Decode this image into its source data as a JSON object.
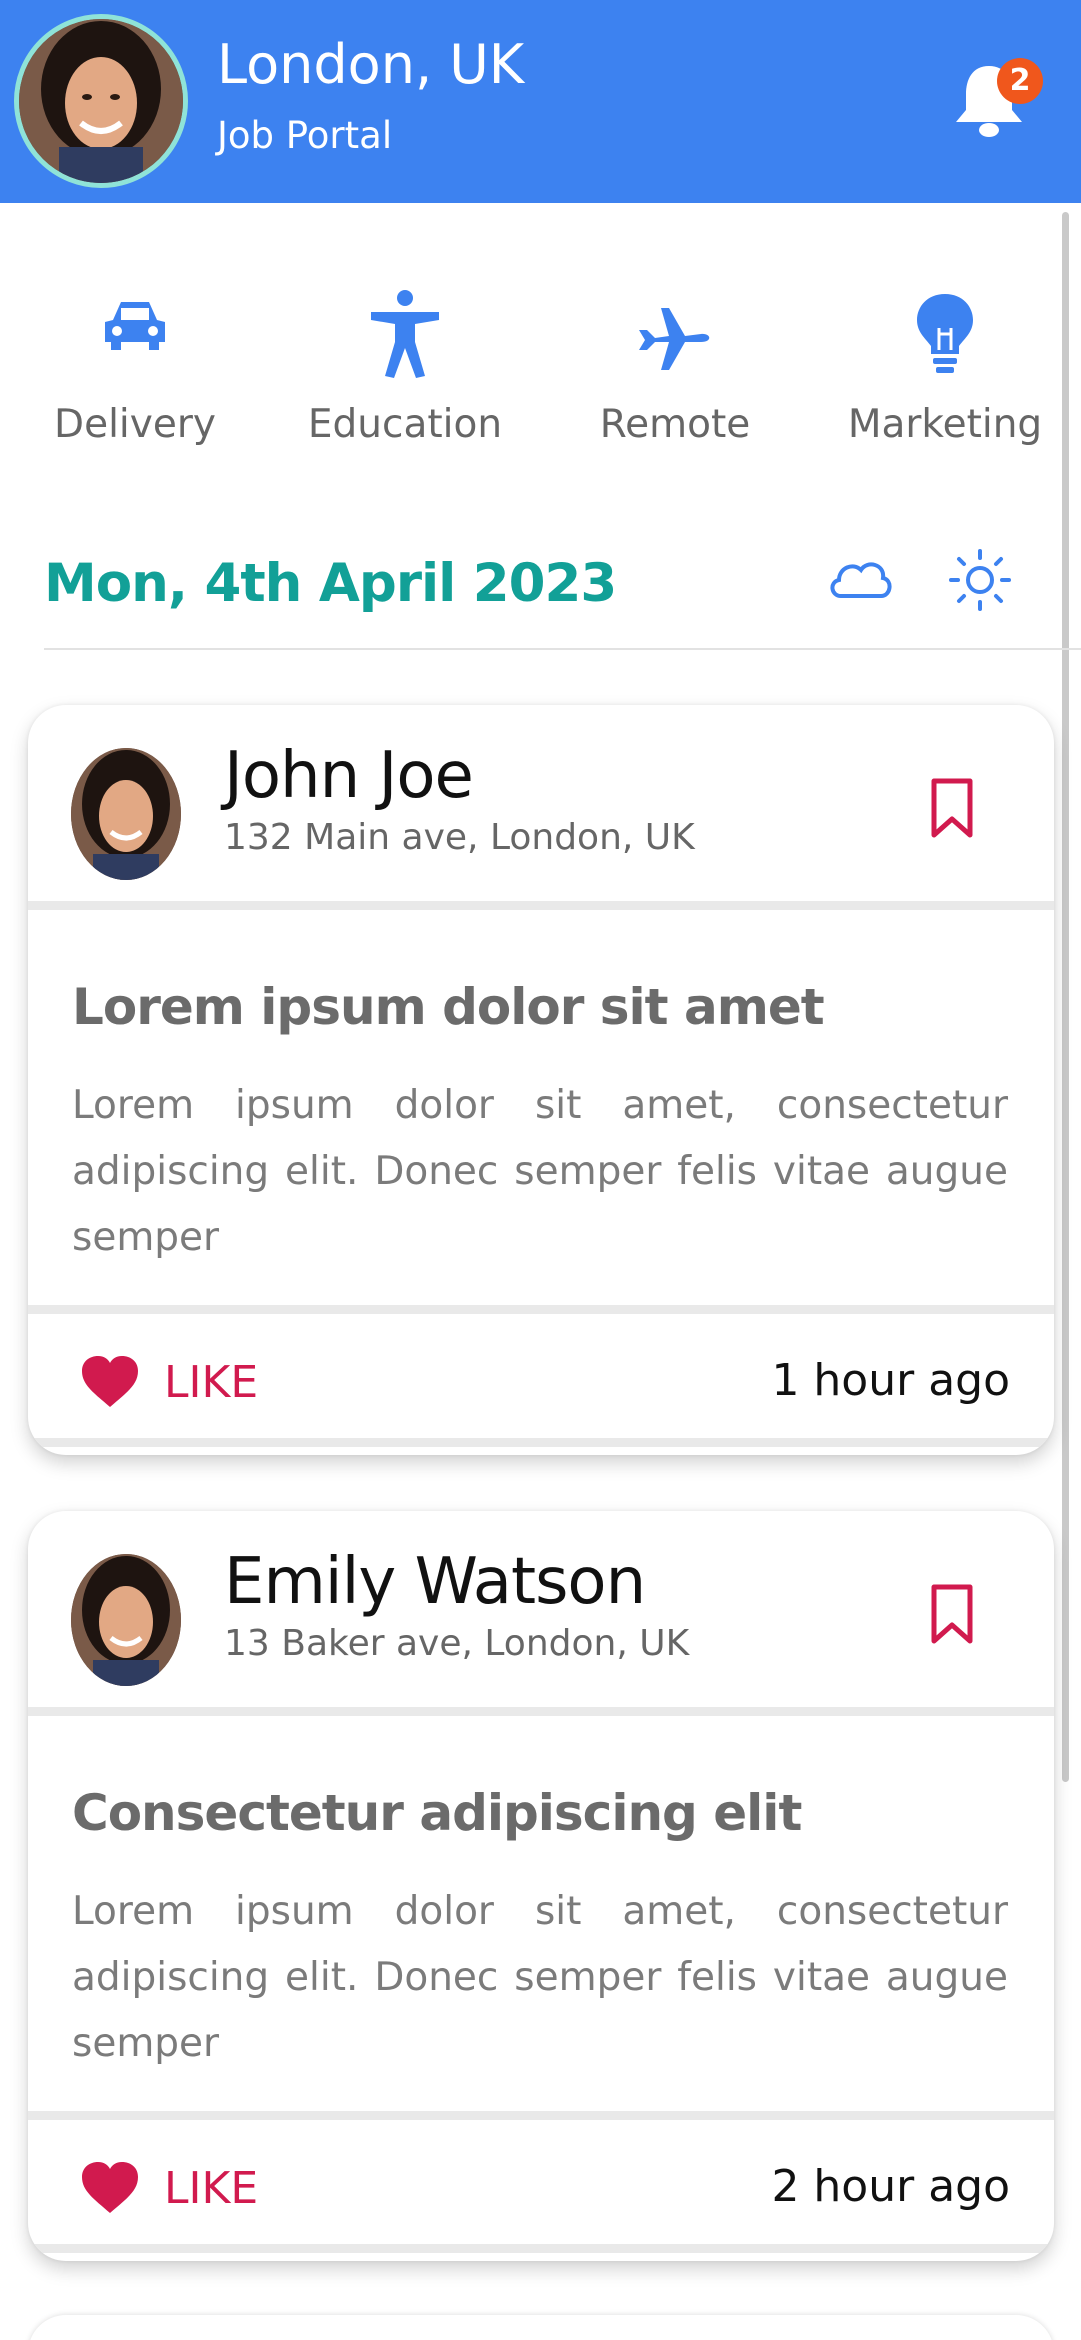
{
  "header": {
    "title": "London, UK",
    "subtitle": "Job Portal",
    "notification_count": "2",
    "accent_color": "#3d82f0"
  },
  "categories": [
    {
      "label": "Delivery",
      "icon": "car-icon"
    },
    {
      "label": "Education",
      "icon": "accessibility-person-icon"
    },
    {
      "label": "Remote",
      "icon": "airplane-icon"
    },
    {
      "label": "Marketing",
      "icon": "lightbulb-icon"
    }
  ],
  "date_bar": {
    "date": "Mon, 4th April 2023",
    "icons": [
      "cloud-icon",
      "sun-icon"
    ],
    "date_color": "#12a097"
  },
  "posts": [
    {
      "name": "John Joe",
      "address": "132 Main ave, London, UK",
      "title": "Lorem ipsum dolor sit amet",
      "body": "Lorem ipsum dolor sit amet, consectetur adipiscing elit. Donec semper felis vitae augue semper",
      "like_label": "LIKE",
      "time": "1 hour ago"
    },
    {
      "name": "Emily Watson",
      "address": "13 Baker ave, London, UK",
      "title": "Consectetur adipiscing elit",
      "body": "Lorem ipsum dolor sit amet, consectetur adipiscing elit. Donec semper felis vitae augue semper",
      "like_label": "LIKE",
      "time": "2 hour ago"
    }
  ],
  "colors": {
    "like": "#d11a4e",
    "icon_blue": "#3d82f0",
    "badge": "#f0571c"
  }
}
